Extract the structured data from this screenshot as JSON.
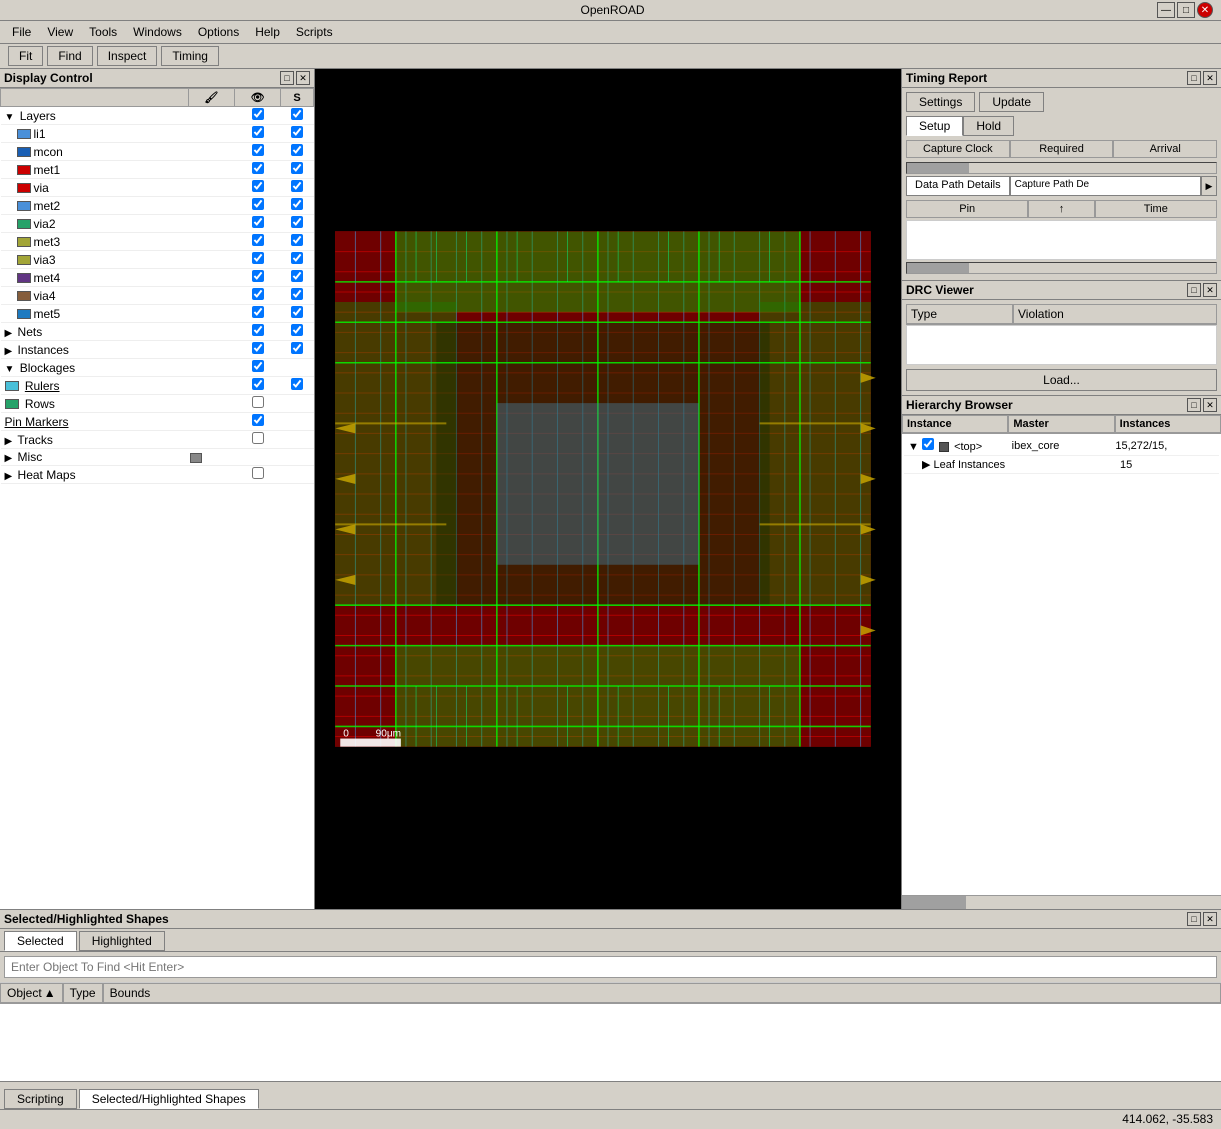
{
  "app": {
    "title": "OpenROAD"
  },
  "titlebar": {
    "minimize": "—",
    "maximize": "□",
    "close": "✕"
  },
  "menubar": {
    "items": [
      "File",
      "View",
      "Tools",
      "Windows",
      "Options",
      "Help",
      "Scripts"
    ]
  },
  "toolbar": {
    "items": [
      "Fit",
      "Find",
      "Inspect",
      "Timing"
    ]
  },
  "display_control": {
    "title": "Display Control",
    "col_paint": "🖌",
    "col_visible": "👁",
    "col_selectable": "S",
    "layers_label": "Layers",
    "layers": [
      {
        "name": "li1",
        "color": "#4a90d9",
        "visible": true,
        "sel": true
      },
      {
        "name": "mcon",
        "color": "#1a5fb4",
        "visible": true,
        "sel": true
      },
      {
        "name": "met1",
        "color": "#cc0000",
        "visible": true,
        "sel": true
      },
      {
        "name": "via",
        "color": "#cc0000",
        "visible": true,
        "sel": true
      },
      {
        "name": "met2",
        "color": "#4a90d9",
        "visible": true,
        "sel": true
      },
      {
        "name": "via2",
        "color": "#26a269",
        "visible": true,
        "sel": true
      },
      {
        "name": "met3",
        "color": "#a2a537",
        "visible": true,
        "sel": true
      },
      {
        "name": "via3",
        "color": "#a2a537",
        "visible": true,
        "sel": true
      },
      {
        "name": "met4",
        "color": "#613583",
        "visible": true,
        "sel": true
      },
      {
        "name": "via4",
        "color": "#865e3c",
        "visible": true,
        "sel": true
      },
      {
        "name": "met5",
        "color": "#1d7ac0",
        "visible": true,
        "sel": true
      }
    ],
    "nets_label": "Nets",
    "nets_visible": true,
    "nets_sel": true,
    "instances_label": "Instances",
    "instances_visible": true,
    "instances_sel": true,
    "blockages_label": "Blockages",
    "blockages_visible": true,
    "rulers_label": "Rulers",
    "rulers_color": "#4ac0d9",
    "rulers_visible": true,
    "rulers_sel": true,
    "rows_label": "Rows",
    "rows_color": "#26a269",
    "rows_visible": false,
    "pin_markers_label": "Pin Markers",
    "pin_markers_visible": true,
    "tracks_label": "Tracks",
    "misc_label": "Misc",
    "heat_maps_label": "Heat Maps"
  },
  "timing_report": {
    "title": "Timing Report",
    "settings_btn": "Settings",
    "update_btn": "Update",
    "tab_setup": "Setup",
    "tab_hold": "Hold",
    "col_capture": "Capture Clock",
    "col_required": "Required",
    "col_arrival": "Arrival",
    "path_data_btn": "Data Path Details",
    "path_capture_btn": "Capture Path De",
    "col_pin": "Pin",
    "col_arrow": "↑",
    "col_time": "Time"
  },
  "drc_viewer": {
    "title": "DRC Viewer",
    "col_type": "Type",
    "col_violation": "Violation",
    "load_btn": "Load..."
  },
  "hierarchy_browser": {
    "title": "Hierarchy Browser",
    "col_instance": "Instance",
    "col_master": "Master",
    "col_instances": "Instances",
    "rows": [
      {
        "name": "<top>",
        "master": "ibex_core",
        "instances": "15,272/15,",
        "expanded": true,
        "checked": true
      },
      {
        "name": "Leaf Instances",
        "master": "",
        "instances": "15",
        "expanded": false,
        "checked": false
      }
    ]
  },
  "selected_shapes": {
    "title": "Selected/Highlighted Shapes",
    "tab_selected": "Selected",
    "tab_highlighted": "Highlighted",
    "search_placeholder": "Enter Object To Find <Hit Enter>",
    "col_object": "Object",
    "col_type": "Type",
    "col_bounds": "Bounds"
  },
  "bottom_tabs": {
    "scripting": "Scripting",
    "selected": "Selected/Highlighted Shapes"
  },
  "status_bar": {
    "coords": "414.062, -35.583"
  },
  "canvas": {
    "scale_label": "90μm",
    "scale_zero": "0"
  }
}
